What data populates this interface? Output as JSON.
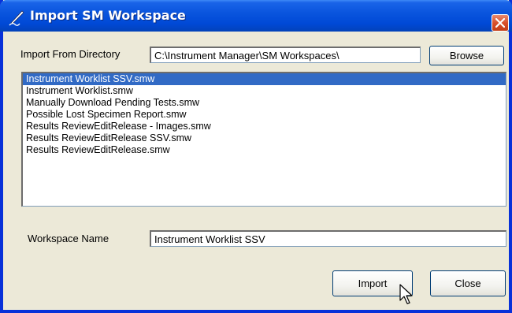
{
  "window": {
    "title": "Import SM Workspace"
  },
  "directory": {
    "label": "Import From Directory",
    "value": "C:\\Instrument Manager\\SM Workspaces\\",
    "browse_label": "Browse"
  },
  "files": {
    "items": [
      "Instrument Worklist SSV.smw",
      "Instrument Worklist.smw",
      "Manually Download Pending Tests.smw",
      "Possible Lost Specimen Report.smw",
      "Results ReviewEditRelease - Images.smw",
      "Results ReviewEditRelease SSV.smw",
      "Results ReviewEditRelease.smw"
    ],
    "selected_index": 0
  },
  "workspace": {
    "label": "Workspace Name",
    "value": "Instrument Worklist SSV"
  },
  "actions": {
    "import_label": "Import",
    "close_label": "Close"
  },
  "colors": {
    "titlebar": "#0a55de",
    "selection": "#316ac5",
    "dialog_bg": "#ece9d8",
    "close_button": "#d9502c"
  }
}
